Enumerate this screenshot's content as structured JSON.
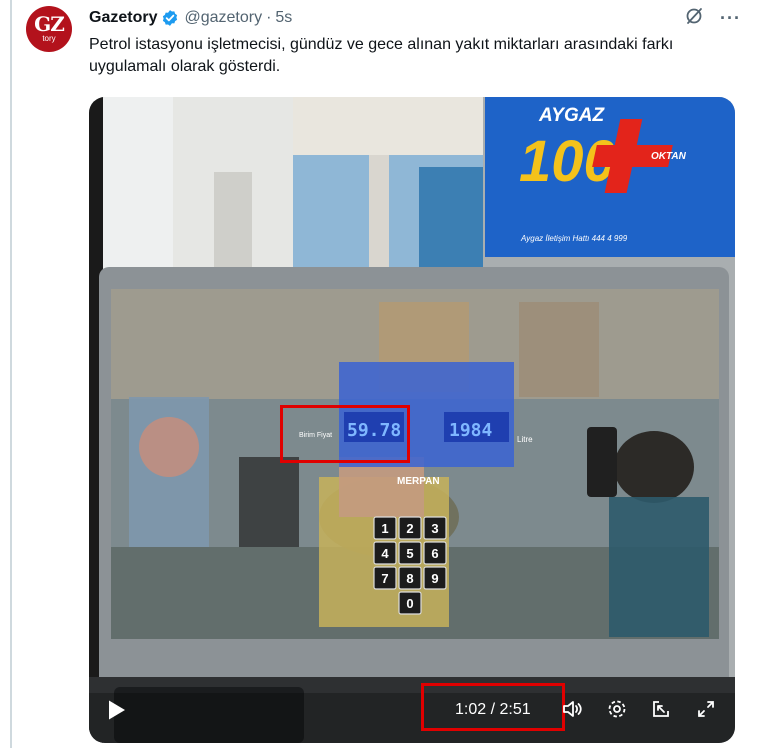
{
  "tweet": {
    "author_name": "Gazetory",
    "handle": "@gazetory",
    "separator": "·",
    "time": "5s",
    "avatar_text": "GZ",
    "avatar_subtext": "tory",
    "text": "Petrol istasyonu işletmecisi, gündüz ve gece alınan yakıt miktarları arasındaki farkı uygulamalı olarak gösterdi.",
    "more_label": "···"
  },
  "media": {
    "brand": "AYGAZ",
    "banner_number": "100",
    "banner_label": "OKTAN",
    "hotline": "Aygaz İletişim Hattı 444 4 999",
    "pump_unit_price": "59.78",
    "pump_liters": "1984",
    "pump_label_left": "Birim Fiyat",
    "pump_label_right": "Litre",
    "pump_brand": "MERPAN",
    "keypad": [
      "1",
      "2",
      "3",
      "4",
      "5",
      "6",
      "7",
      "8",
      "9",
      "0"
    ]
  },
  "video": {
    "timecode": "1:02 / 2:51",
    "progress": 0.363
  },
  "colors": {
    "verified": "#1d9bf0",
    "avatar": "#b3121c",
    "highlight": "#e00000",
    "banner_blue": "#1e63c8",
    "pump_screen": "#3a63d4"
  },
  "icons": [
    "verified-badge-icon",
    "grok-icon",
    "more-icon",
    "play-icon",
    "volume-icon",
    "settings-icon",
    "pip-icon",
    "fullscreen-icon"
  ]
}
